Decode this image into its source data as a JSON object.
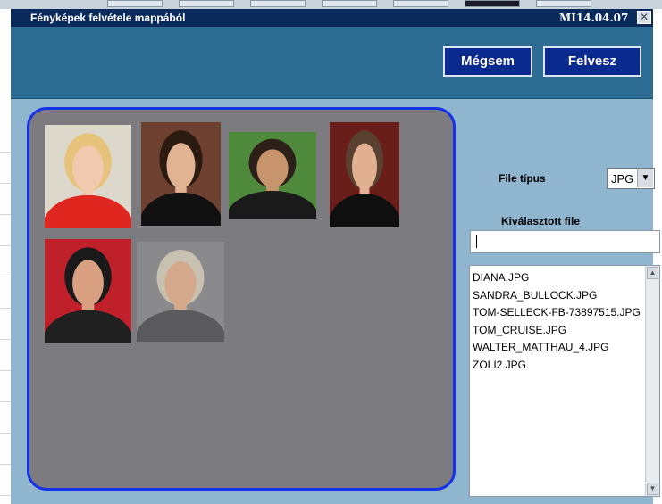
{
  "window": {
    "title": "Fényképek felvétele mappából",
    "version": "MI14.04.07",
    "close_label": "✕"
  },
  "toolbar": {
    "cancel_label": "Mégsem",
    "add_label": "Felvesz"
  },
  "filetype": {
    "label": "File típus",
    "value": "JPG",
    "dropdown_arrow": "▼"
  },
  "selected_file": {
    "label": "Kiválasztott file",
    "value": ""
  },
  "file_list": {
    "items": [
      "DIANA.JPG",
      "SANDRA_BULLOCK.JPG",
      "TOM-SELLECK-FB-73897515.JPG",
      "TOM_CRUISE.JPG",
      "WALTER_MATTHAU_4.JPG",
      "ZOLI2.JPG"
    ],
    "scroll_up": "▲",
    "scroll_down": "▼"
  },
  "gallery": {
    "photos": [
      {
        "name": "portrait-woman-short-blonde-hair",
        "bg": "#ddd8cc",
        "hair": "#e6c27a",
        "skin": "#f1c9ae",
        "top": "#e0271f"
      },
      {
        "name": "portrait-woman-long-dark-hair",
        "bg": "#6e4030",
        "hair": "#2a1a10",
        "skin": "#e2b393",
        "top": "#111111"
      },
      {
        "name": "portrait-man-mustache-outdoors",
        "bg": "#4f8a3c",
        "hair": "#2c2018",
        "skin": "#c8946e",
        "top": "#1a1a1a"
      },
      {
        "name": "portrait-man-tuxedo",
        "bg": "#6a1e1a",
        "hair": "#5a4030",
        "skin": "#e0b090",
        "top": "#0f0f10"
      },
      {
        "name": "portrait-man-red-background",
        "bg": "#c0202a",
        "hair": "#1a1a1a",
        "skin": "#d8a080",
        "top": "#202020"
      },
      {
        "name": "portrait-older-man-glasses",
        "bg": "#8a8a8c",
        "hair": "#c8c0b0",
        "skin": "#d4a88a",
        "top": "#5a5a5c"
      }
    ]
  }
}
